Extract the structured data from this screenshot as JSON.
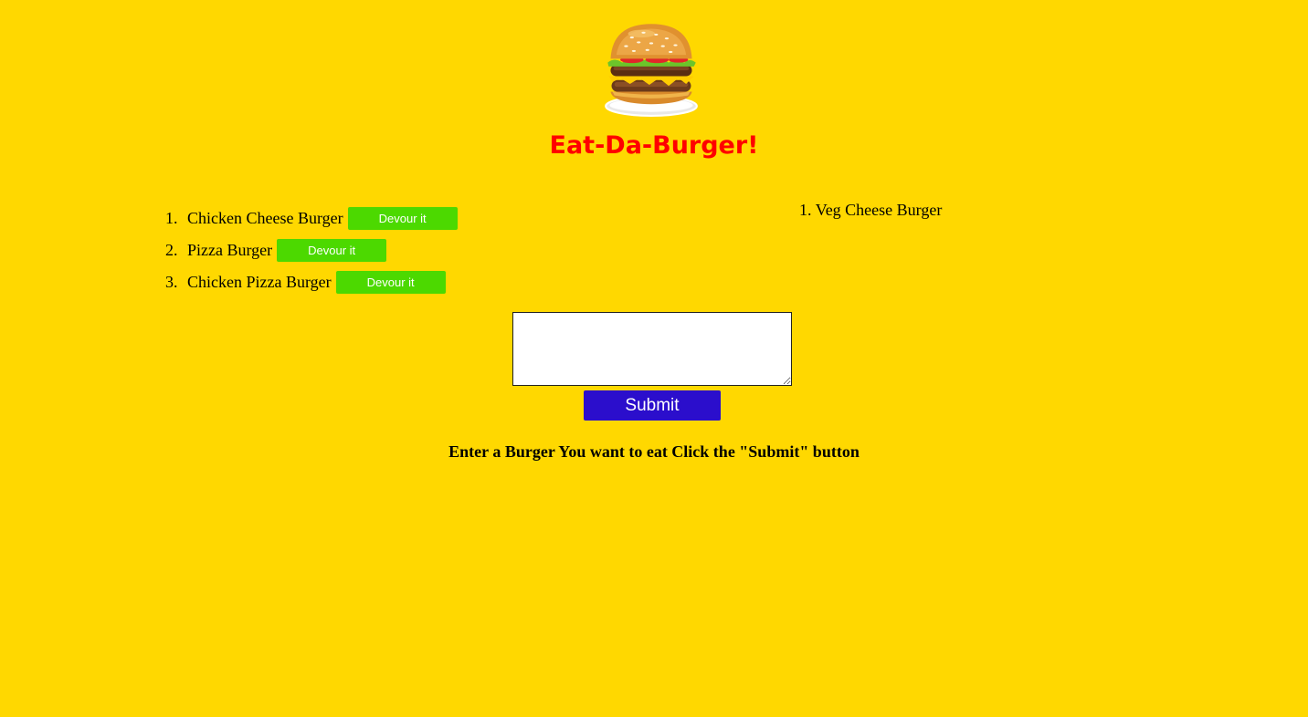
{
  "header": {
    "logo_icon": "hamburger-icon",
    "title": "Eat-Da-Burger!",
    "title_color": "#ff0000"
  },
  "page": {
    "background_color": "#ffd800"
  },
  "to_eat": {
    "items": [
      {
        "number": "1.",
        "name": "Chicken Cheese Burger",
        "button_label": "Devour it"
      },
      {
        "number": "2.",
        "name": "Pizza Burger",
        "button_label": "Devour it"
      },
      {
        "number": "3.",
        "name": "Chicken Pizza Burger",
        "button_label": "Devour it"
      }
    ],
    "button_color": "#4cd900"
  },
  "devoured": {
    "items": [
      {
        "number": "1.",
        "name": "Veg Cheese Burger"
      }
    ]
  },
  "form": {
    "input_value": "",
    "submit_label": "Submit",
    "submit_color": "#2b0ecc",
    "instructions": "Enter a Burger You want to eat Click the \"Submit\" button"
  }
}
